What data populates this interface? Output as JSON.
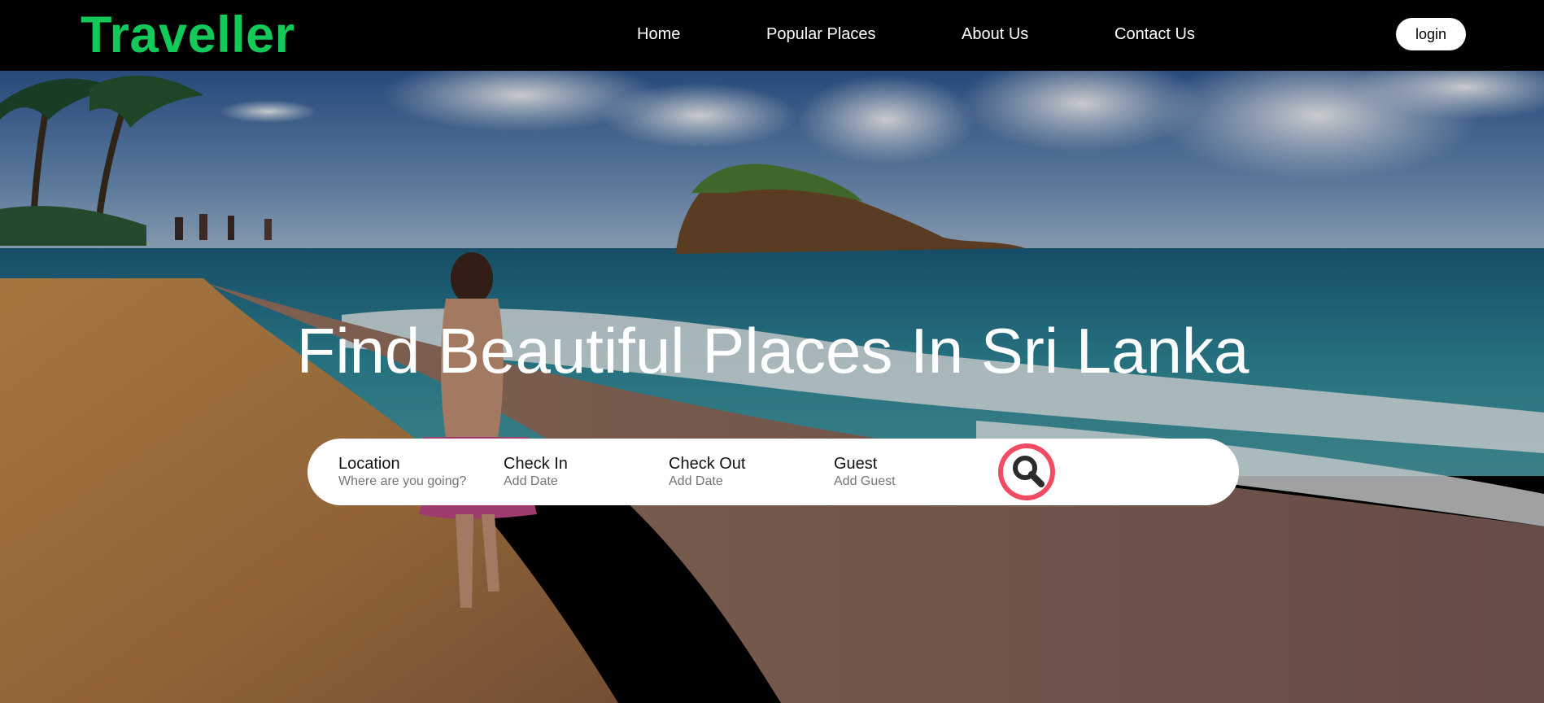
{
  "brand": {
    "name": "Traveller",
    "color": "#12c95a"
  },
  "nav": {
    "items": [
      {
        "label": "Home"
      },
      {
        "label": "Popular Places"
      },
      {
        "label": "About Us"
      },
      {
        "label": "Contact Us"
      }
    ],
    "login_label": "login"
  },
  "hero": {
    "headline": "Find Beautiful Places In Sri Lanka",
    "image": "beach-hero-image"
  },
  "search": {
    "fields": [
      {
        "label": "Location",
        "hint": "Where are you going?"
      },
      {
        "label": "Check In",
        "hint": "Add Date"
      },
      {
        "label": "Check Out",
        "hint": "Add Date"
      },
      {
        "label": "Guest",
        "hint": "Add Guest"
      }
    ],
    "button_icon": "search-icon",
    "accent": "#f24b62"
  }
}
